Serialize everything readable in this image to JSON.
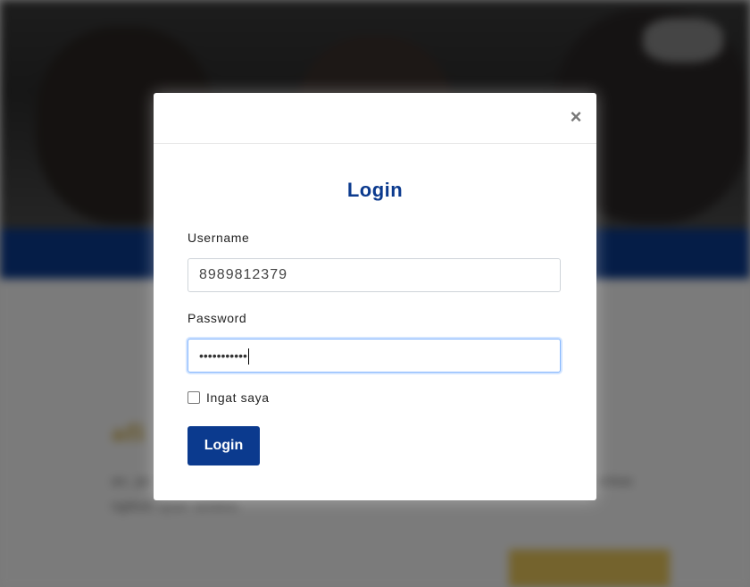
{
  "background": {
    "heading_fragment": "afi",
    "text_line_1": "an, pe",
    "text_line_2": "ngikuti ujian seleksi.",
    "text_right_fragment": "erkas"
  },
  "modal": {
    "close_glyph": "×",
    "title": "Login",
    "username_label": "Username",
    "username_value": "8989812379",
    "password_label": "Password",
    "password_masked": "•••••••••••",
    "remember_label": "Ingat saya",
    "remember_checked": false,
    "submit_label": "Login"
  },
  "colors": {
    "brand_blue": "#0b3a8e",
    "accent_gold": "#c9a53a"
  }
}
